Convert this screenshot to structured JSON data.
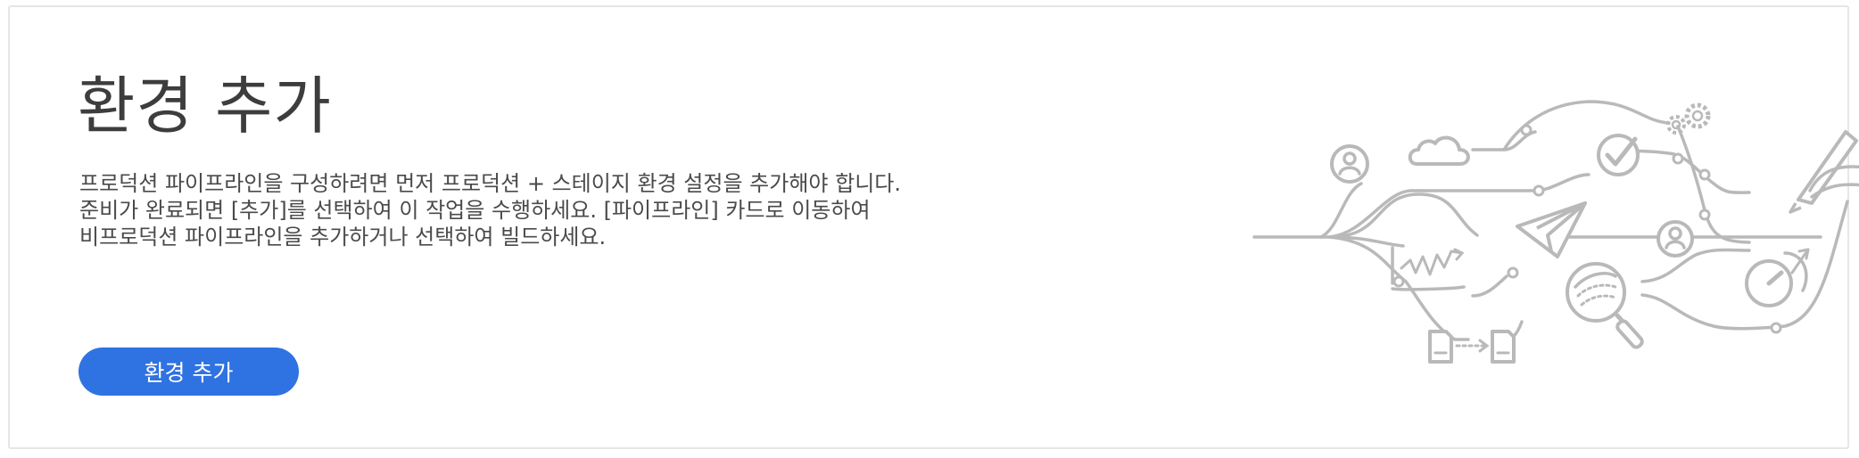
{
  "page": {
    "title": "환경 추가",
    "description_lines": [
      "프로덕션 파이프라인을 구성하려면 먼저 프로덕션 + 스테이지 환경 설정을 추가해야 합니다.",
      "준비가 완료되면 [추가]를 선택하여 이 작업을 수행하세요. [파이프라인] 카드로 이동하여",
      "비프로덕션 파이프라인을 추가하거나 선택하여 빌드하세요."
    ],
    "add_button_label": "환경 추가"
  },
  "illustration": {
    "icons": [
      "user-icon",
      "cloud-icon",
      "checkmark-icon",
      "gear-icon",
      "pen-icon",
      "paper-plane-icon",
      "user-icon",
      "chart-icon",
      "search-icon",
      "speedometer-icon",
      "document-icon",
      "document-icon"
    ]
  },
  "colors": {
    "button": "#2f72e2",
    "title": "#3d3d3d",
    "text": "#4a4a4a",
    "illustration_stroke": "#b9b9b9",
    "panel_border": "#e6e6e6"
  }
}
